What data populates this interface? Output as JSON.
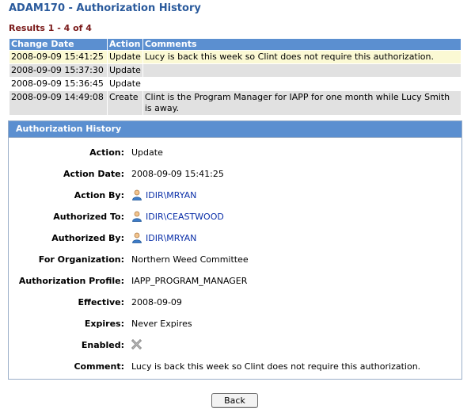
{
  "title": "ADAM170 - Authorization History",
  "results": "Results 1 - 4 of 4",
  "table": {
    "headers": [
      "Change Date",
      "Action",
      "Comments"
    ],
    "rows": [
      {
        "date": "2008-09-09 15:41:25",
        "action": "Update",
        "comment": "Lucy is back this week so Clint does not require this authorization."
      },
      {
        "date": "2008-09-09 15:37:30",
        "action": "Update",
        "comment": ""
      },
      {
        "date": "2008-09-09 15:36:45",
        "action": "Update",
        "comment": ""
      },
      {
        "date": "2008-09-09 14:49:08",
        "action": "Create",
        "comment": "Clint is the Program Manager for IAPP for one month while Lucy Smith is away."
      }
    ]
  },
  "details": {
    "heading": "Authorization History",
    "action_label": "Action:",
    "action": "Update",
    "action_date_label": "Action Date:",
    "action_date": "2008-09-09 15:41:25",
    "action_by_label": "Action By:",
    "action_by": "IDIR\\MRYAN",
    "authorized_to_label": "Authorized To:",
    "authorized_to": "IDIR\\CEASTWOOD",
    "authorized_by_label": "Authorized By:",
    "authorized_by": "IDIR\\MRYAN",
    "organization_label": "For Organization:",
    "organization": "Northern Weed Committee",
    "profile_label": "Authorization Profile:",
    "profile": "IAPP_PROGRAM_MANAGER",
    "effective_label": "Effective:",
    "effective": "2008-09-09",
    "expires_label": "Expires:",
    "expires": "Never Expires",
    "enabled_label": "Enabled:",
    "enabled_icon": "x-icon",
    "comment_label": "Comment:",
    "comment": "Lucy is back this week so Clint does not require this authorization."
  },
  "back_label": "Back",
  "colors": {
    "title": "#2a5a9c",
    "header_bg": "#5b8fd0",
    "highlight_row": "#fbf9d4",
    "gray_row": "#e1e1e1",
    "results_text": "#7a1a1a",
    "link": "#0a2fa8"
  }
}
